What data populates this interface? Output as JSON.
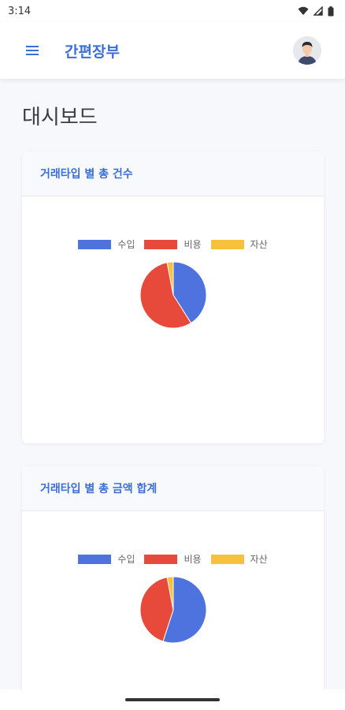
{
  "status_bar": {
    "time": "3:14"
  },
  "app_bar": {
    "title": "간편장부"
  },
  "page": {
    "title": "대시보드"
  },
  "colors": {
    "income": "#4e73df",
    "expense": "#e74a3b",
    "asset": "#f6c23e",
    "brand": "#3a6fd8"
  },
  "cards": [
    {
      "title": "거래타입 별 총 건수",
      "legend": [
        "수입",
        "비용",
        "자산"
      ],
      "chart_data": {
        "type": "pie",
        "categories": [
          "수입",
          "비용",
          "자산"
        ],
        "values": [
          41,
          56,
          3
        ]
      }
    },
    {
      "title": "거래타입 별 총 금액 합계",
      "legend": [
        "수입",
        "비용",
        "자산"
      ],
      "chart_data": {
        "type": "pie",
        "categories": [
          "수입",
          "비용",
          "자산"
        ],
        "values": [
          55,
          42,
          3
        ]
      }
    }
  ]
}
